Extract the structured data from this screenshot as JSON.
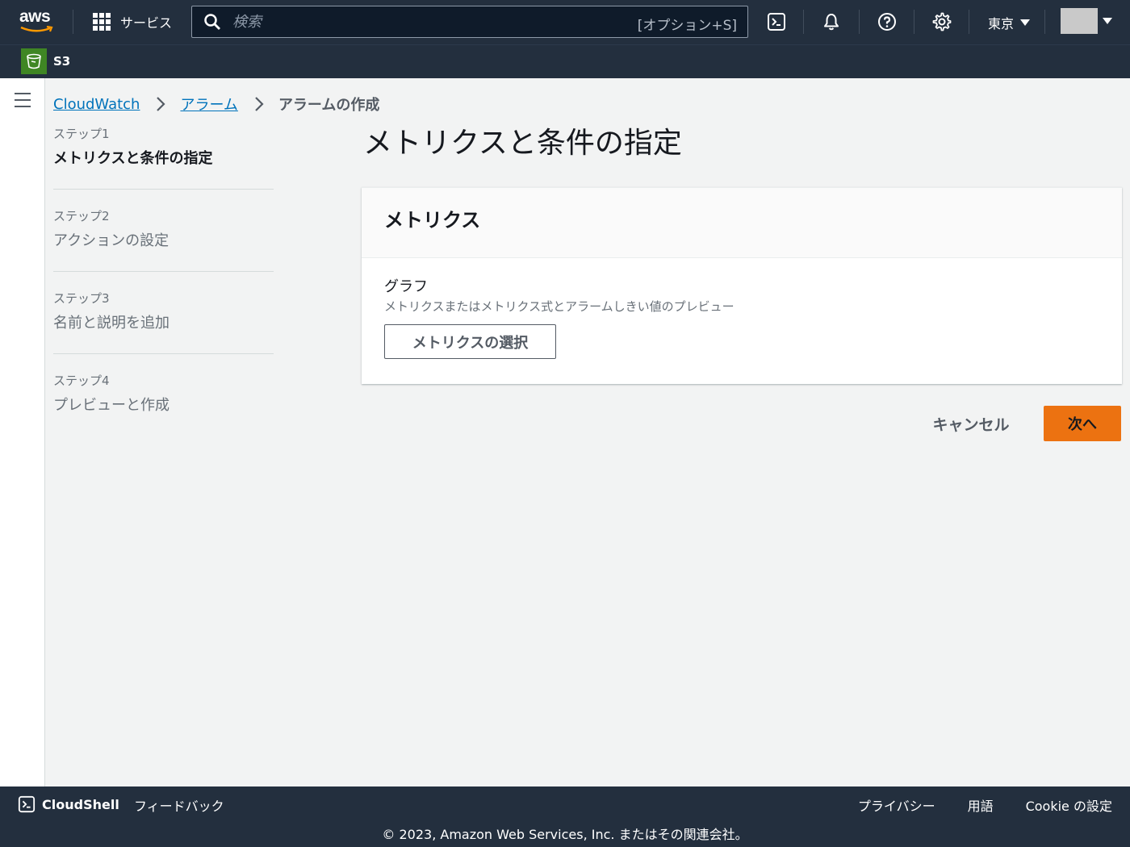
{
  "topnav": {
    "logo_text": "aws",
    "services_label": "サービス",
    "search_placeholder": "検索",
    "search_shortcut": "[オプション+S]",
    "region_label": "東京"
  },
  "subnav": {
    "favorite_label": "S3"
  },
  "breadcrumb": {
    "items": [
      "CloudWatch",
      "アラーム"
    ],
    "current": "アラームの作成"
  },
  "steps": [
    {
      "number": "ステップ1",
      "title": "メトリクスと条件の指定"
    },
    {
      "number": "ステップ2",
      "title": "アクションの設定"
    },
    {
      "number": "ステップ3",
      "title": "名前と説明を追加"
    },
    {
      "number": "ステップ4",
      "title": "プレビューと作成"
    }
  ],
  "main": {
    "page_title": "メトリクスと条件の指定",
    "panel_title": "メトリクス",
    "graph_label": "グラフ",
    "graph_description": "メトリクスまたはメトリクス式とアラームしきい値のプレビュー",
    "select_metric_button": "メトリクスの選択",
    "cancel_button": "キャンセル",
    "next_button": "次へ"
  },
  "footer": {
    "cloudshell_label": "CloudShell",
    "feedback_label": "フィードバック",
    "links": [
      "プライバシー",
      "用語",
      "Cookie の設定"
    ],
    "copyright": "© 2023, Amazon Web Services, Inc. またはその関連会社。"
  },
  "colors": {
    "nav_bg": "#232f3e",
    "link": "#0073bb",
    "primary_button": "#ec7211",
    "s3_badge": "#3f8624"
  }
}
